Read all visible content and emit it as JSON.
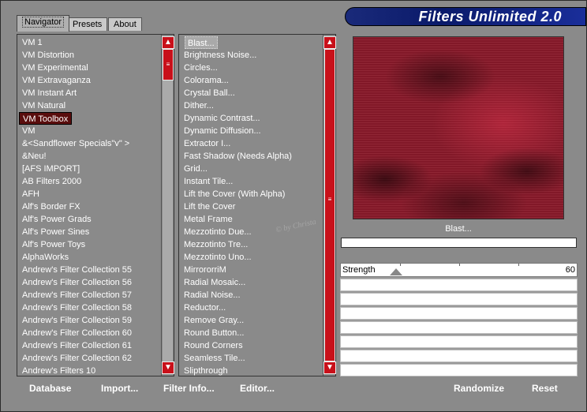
{
  "tabs": [
    "Navigator",
    "Presets",
    "About"
  ],
  "title": "Filters Unlimited 2.0",
  "categories": [
    "VM 1",
    "VM Distortion",
    "VM Experimental",
    "VM Extravaganza",
    "VM Instant Art",
    "VM Natural",
    "VM Toolbox",
    "VM",
    "&<Sandflower Specials\"v\" >",
    "&Neu!",
    "[AFS IMPORT]",
    "AB Filters 2000",
    "AFH",
    "Alf's Border FX",
    "Alf's Power Grads",
    "Alf's Power Sines",
    "Alf's Power Toys",
    "AlphaWorks",
    "Andrew's Filter Collection 55",
    "Andrew's Filter Collection 56",
    "Andrew's Filter Collection 57",
    "Andrew's Filter Collection 58",
    "Andrew's Filter Collection 59",
    "Andrew's Filter Collection 60",
    "Andrew's Filter Collection 61",
    "Andrew's Filter Collection 62",
    "Andrew's Filters 10"
  ],
  "selected_category": "VM Toolbox",
  "filters": [
    "Blast...",
    "Brightness Noise...",
    "Circles...",
    "Colorama...",
    "Crystal Ball...",
    "Dither...",
    "Dynamic Contrast...",
    "Dynamic Diffusion...",
    "Extractor I...",
    "Fast Shadow (Needs Alpha)",
    "Grid...",
    "Instant Tile...",
    "Lift the Cover (With Alpha)",
    "Lift the Cover",
    "Metal Frame",
    "Mezzotinto Due...",
    "Mezzotinto Tre...",
    "Mezzotinto Uno...",
    "MirrororriM",
    "Radial Mosaic...",
    "Radial Noise...",
    "Reductor...",
    "Remove Gray...",
    "Round Button...",
    "Round Corners",
    "Seamless Tile...",
    "Slipthrough"
  ],
  "selected_filter": "Blast...",
  "preview_name": "Blast...",
  "param": {
    "label": "Strength",
    "value": "60",
    "level": 0.235
  },
  "watermark": "© by Christa",
  "buttons": {
    "database": "Database",
    "import": "Import...",
    "filter_info": "Filter Info...",
    "editor": "Editor...",
    "randomize": "Randomize",
    "reset": "Reset"
  },
  "colors": {
    "accent_red": "#c8101a",
    "selected_bg": "#5a0e0e",
    "header_blue": "#0a1a6a"
  }
}
